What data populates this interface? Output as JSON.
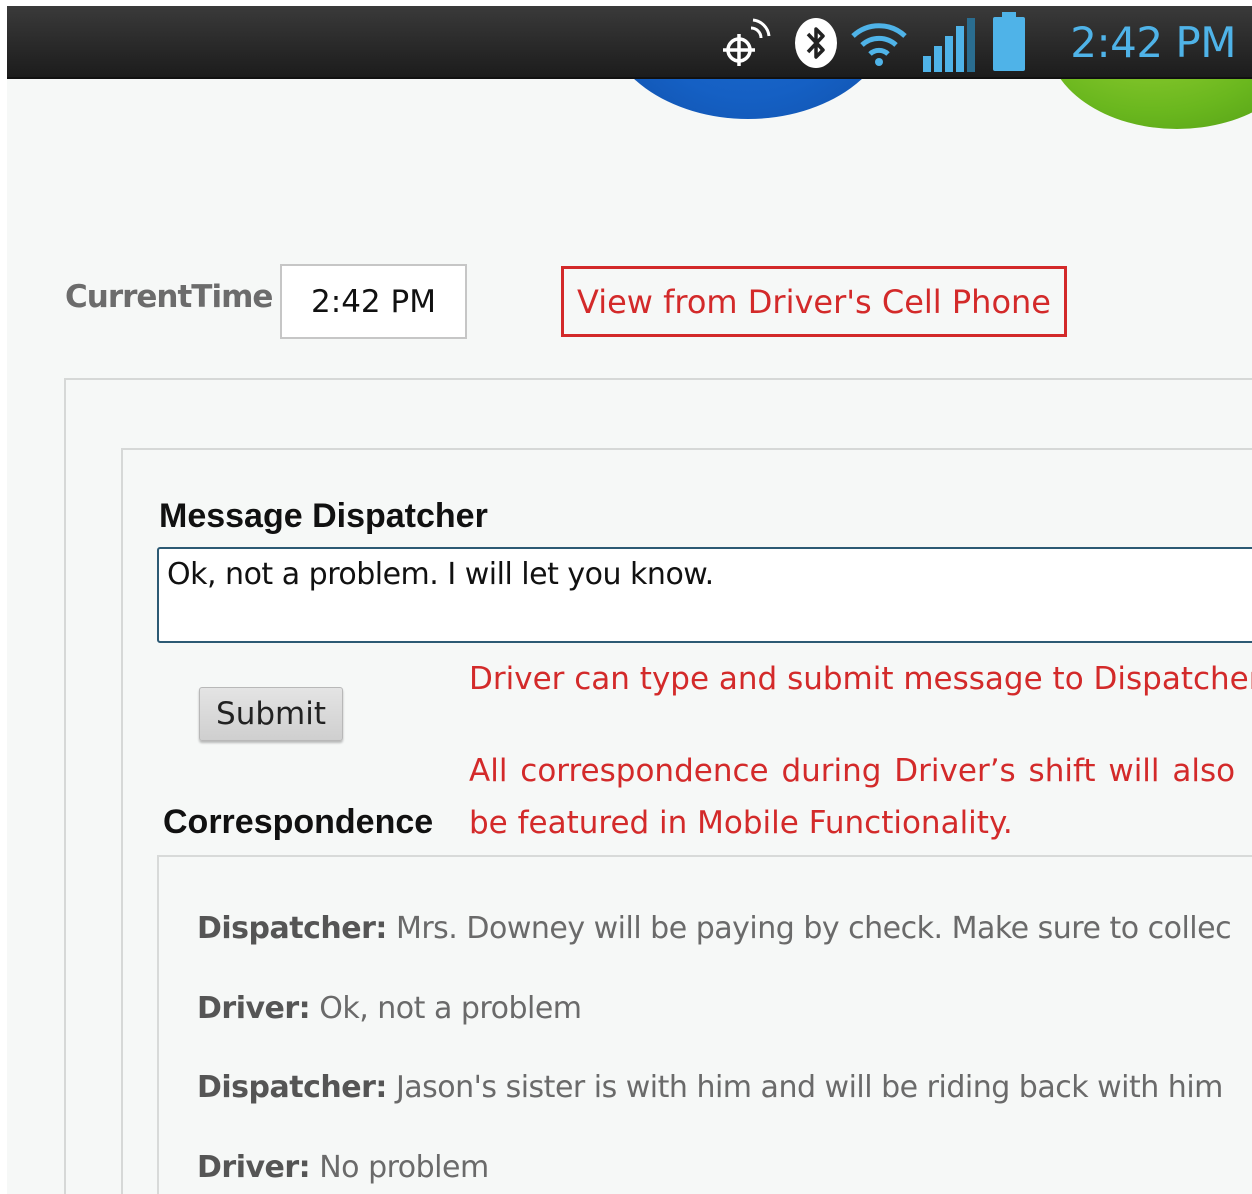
{
  "status_bar": {
    "time": "2:42 PM",
    "icons": [
      "gps-icon",
      "bluetooth-icon",
      "wifi-icon",
      "signal-icon",
      "battery-icon"
    ],
    "time_color": "#4fb3e8"
  },
  "current_time": {
    "label": "CurrentTime",
    "value": "2:42 PM"
  },
  "callout": {
    "text": "View from Driver's Cell Phone"
  },
  "message": {
    "heading": "Message Dispatcher",
    "input_value": "Ok, not a problem. I will let you know.",
    "submit_label": "Submit"
  },
  "annotations": {
    "type_submit": "Driver can type and submit message to Dispatcher",
    "correspondence_line1": "All correspondence during Driver’s shift will also",
    "correspondence_line2": "be featured in Mobile Functionality."
  },
  "correspondence": {
    "heading": "Correspondence",
    "entries": [
      {
        "speaker": "Dispatcher:",
        "text": "Mrs. Downey will be paying by check. Make sure to collec"
      },
      {
        "speaker": "Driver:",
        "text": "Ok, not a problem"
      },
      {
        "speaker": "Dispatcher:",
        "text": "Jason's sister is with him and will be riding back with him"
      },
      {
        "speaker": "Driver:",
        "text": "No problem"
      }
    ]
  },
  "colors": {
    "annotation_red": "#d32a2a",
    "input_border": "#2d5a74",
    "logo_blue": "#1560c4",
    "logo_green": "#6ab71e"
  }
}
